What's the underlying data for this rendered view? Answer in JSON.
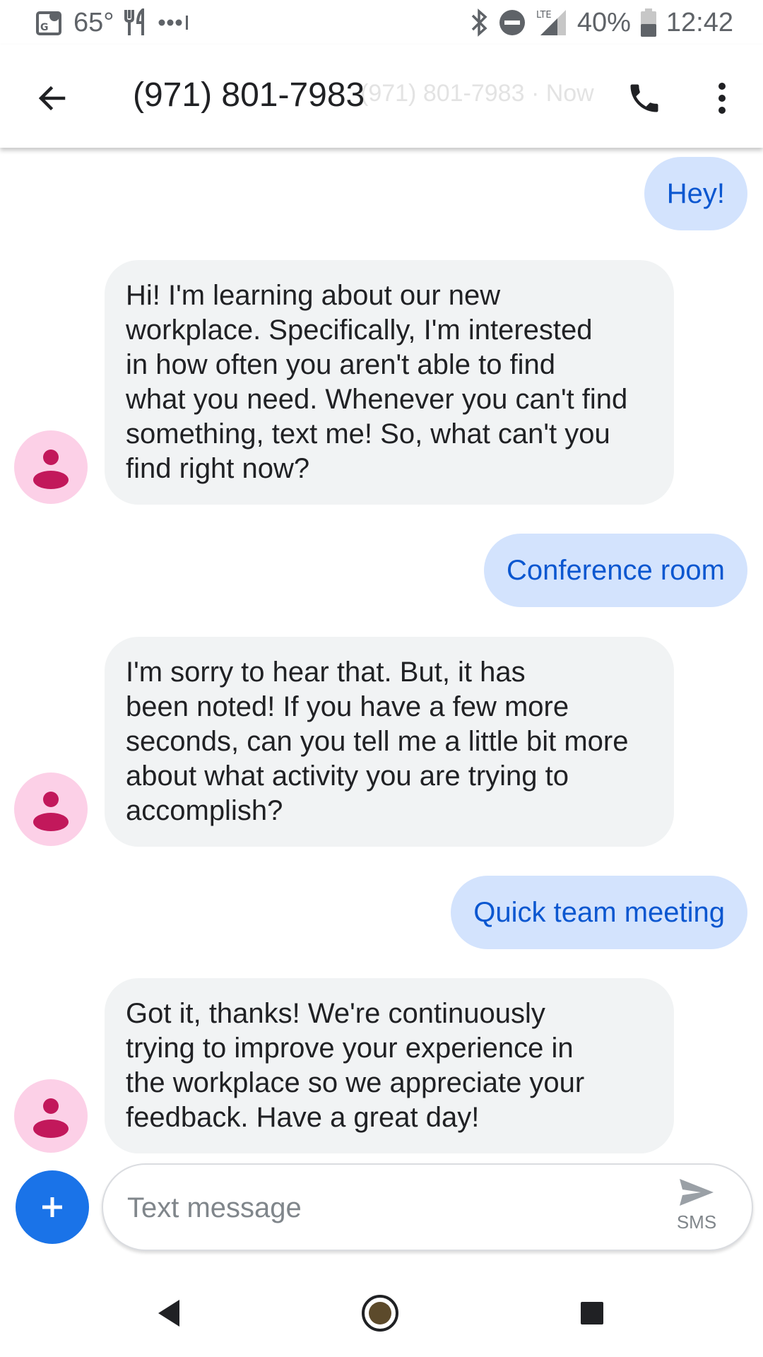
{
  "status_bar": {
    "temperature": "65°",
    "battery": "40%",
    "time": "12:42",
    "network": "LTE"
  },
  "app_bar": {
    "title": "(971) 801-7983",
    "ghost_subtitle": "(971) 801-7983 · Now"
  },
  "messages": [
    {
      "direction": "out",
      "text": "Hey!"
    },
    {
      "direction": "in",
      "text": "Hi! I'm learning about our new\nworkplace. Specifically, I'm interested\nin how often you aren't able to find\nwhat you need. Whenever you can't find\nsomething, text me! So, what can't you\nfind right now?"
    },
    {
      "direction": "out",
      "text": "Conference room"
    },
    {
      "direction": "in",
      "text": "I'm sorry to hear that. But, it has\nbeen noted! If you have a few more\nseconds, can you tell me a little bit more\nabout what activity you are trying to\naccomplish?"
    },
    {
      "direction": "out",
      "text": "Quick team meeting"
    },
    {
      "direction": "in",
      "text": "Got it, thanks! We're continuously\ntrying to improve your experience in\nthe workplace so we appreciate your\nfeedback. Have a great day!"
    }
  ],
  "compose": {
    "placeholder": "Text message",
    "send_label": "SMS"
  },
  "colors": {
    "outgoing_bubble": "#d3e3fd",
    "outgoing_text": "#0b57d0",
    "incoming_bubble": "#f1f3f4",
    "avatar_bg": "#fcd0e7",
    "avatar_fg": "#c2185b",
    "fab": "#1a73e8"
  },
  "icons": {
    "status_left": [
      "map-pin-icon",
      "restaurant-icon",
      "dots-icon"
    ],
    "status_right": [
      "bluetooth-icon",
      "do-not-disturb-icon",
      "signal-icon",
      "battery-icon"
    ],
    "app_bar": [
      "back-arrow-icon",
      "phone-icon",
      "more-vert-icon"
    ],
    "nav": [
      "nav-back-icon",
      "nav-home-icon",
      "nav-recents-icon"
    ]
  }
}
